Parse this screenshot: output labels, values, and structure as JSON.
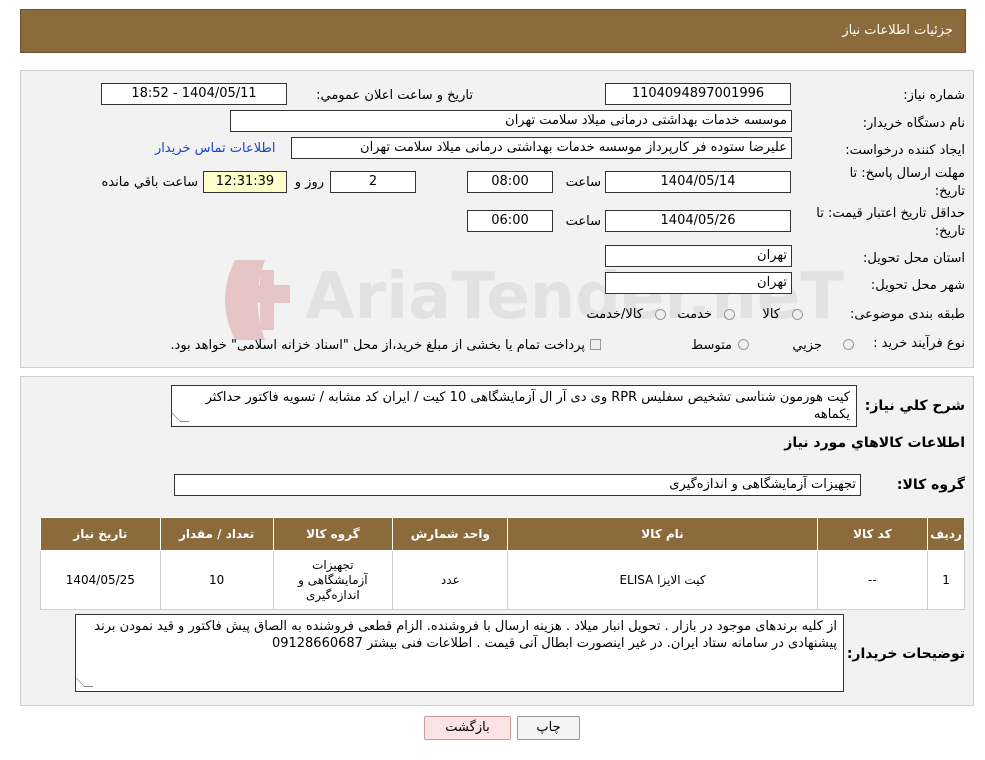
{
  "header": {
    "title": "جزئیات اطلاعات نیاز"
  },
  "watermark": {
    "text": "AriaTender.neT"
  },
  "form": {
    "need_number_label": "شماره نیاز:",
    "need_number": "1104094897001996",
    "announce_label": "تاریخ و ساعت اعلان عمومي:",
    "announce_value": "1404/05/11 - 18:52",
    "buyer_org_label": "نام دستگاه خریدار:",
    "buyer_org": "موسسه خدمات بهداشتی درمانی میلاد سلامت تهران",
    "creator_label": "ایجاد کننده درخواست:",
    "creator": "علیرضا ستوده فر کارپرداز موسسه خدمات بهداشتی درمانی میلاد سلامت تهران",
    "contact_link": "اطلاعات تماس خریدار",
    "deadline_label_1": "مهلت ارسال پاسخ: تا",
    "deadline_label_2": "تاریخ:",
    "deadline_date": "1404/05/14",
    "time_label": "ساعت",
    "deadline_time": "08:00",
    "days": "2",
    "days_label": "روز و",
    "remaining_time": "12:31:39",
    "remaining_label": "ساعت باقي مانده",
    "price_valid_label_1": "حداقل تاریخ اعتبار قیمت: تا",
    "price_valid_label_2": "تاریخ:",
    "price_valid_date": "1404/05/26",
    "price_valid_time": "06:00",
    "province_label": "استان محل تحویل:",
    "province": "تهران",
    "city_label": "شهر محل تحویل:",
    "city": "تهران",
    "category_label": "طبقه بندی موضوعی:",
    "category_options": [
      "کالا",
      "خدمت",
      "کالا/خدمت"
    ],
    "process_label": "نوع فرآیند خرید :",
    "process_options": [
      "جزيي",
      "متوسط"
    ],
    "process_note": "پرداخت تمام یا بخشی از مبلغ خرید،از محل \"اسناد خزانه اسلامی\" خواهد بود."
  },
  "summary": {
    "desc_label": "شرح کلي نياز:",
    "desc_text": "کیت هورمون شناسی تشخیص سفلیس RPR وی دی آر ال آزمایشگاهی 10 کیت / ایران کد مشابه / تسویه فاکتور حداکثر یکماهه",
    "items_heading": "اطلاعات کالاهاي مورد نياز",
    "group_label": "گروه کالا:",
    "group_value": "تجهیزات آزمایشگاهی و اندازه‌گیری"
  },
  "table": {
    "headers": [
      "رديف",
      "کد کالا",
      "نام کالا",
      "واحد شمارش",
      "گروه کالا",
      "تعداد / مقدار",
      "تاريخ نياز"
    ],
    "rows": [
      [
        "1",
        "--",
        "کیت الایزا ELISA",
        "عدد",
        "تجهیزات آزمایشگاهی و اندازه‌گیری",
        "10",
        "1404/05/25"
      ]
    ]
  },
  "notes": {
    "label": "توضیحات خریدار:",
    "text": "از کلیه برندهای موجود در بازار . تحویل انبار میلاد . هزینه ارسال با فروشنده. الزام قطعی فروشنده به الصاق پیش فاکتور و قید نمودن برند پیشنهادی در سامانه ستاد ایران. در غیر اینصورت ابطال آنی قیمت . اطلاعات فنی بیشتر 09128660687"
  },
  "buttons": {
    "print": "چاپ",
    "back": "بازگشت"
  },
  "colors": {
    "header_bg": "#8b6a3c",
    "link": "#1a45c7",
    "back_button_bg": "#fbe3e3"
  }
}
